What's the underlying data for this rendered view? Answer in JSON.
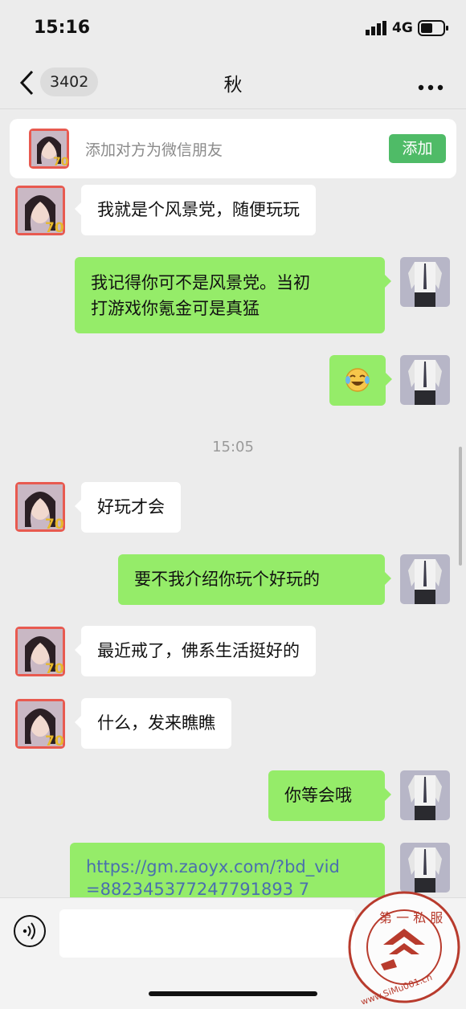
{
  "status": {
    "time": "15:16",
    "network": "4G"
  },
  "header": {
    "unread_count": "3402",
    "title": "秋"
  },
  "add_friend": {
    "prompt": "添加对方为微信朋友",
    "button_label": "添加"
  },
  "timestamp": "15:05",
  "messages": [
    {
      "side": "in",
      "text": "我就是个风景党，随便玩玩"
    },
    {
      "side": "out",
      "lines": [
        "我记得你可不是风景党。当初",
        "打游戏你氪金可是真猛"
      ]
    },
    {
      "side": "out",
      "emoji": "laughing-crying-emoji"
    },
    {
      "side": "in",
      "text": "好玩才会"
    },
    {
      "side": "out",
      "text": "要不我介绍你玩个好玩的"
    },
    {
      "side": "in",
      "text": "最近戒了，佛系生活挺好的"
    },
    {
      "side": "in",
      "text": "什么，发来瞧瞧"
    },
    {
      "side": "out",
      "text": "你等会哦"
    },
    {
      "side": "out",
      "link_lines": [
        "https://gm.zaoyx.com/?bd_vid",
        "=882345377247791893 7"
      ]
    }
  ],
  "watermark": {
    "top": "第 一 私 服",
    "bottom": "www.SiMu001.cn"
  },
  "colors": {
    "outgoing_bubble": "#95ec69",
    "incoming_bubble": "#ffffff",
    "add_button": "#4fbb67",
    "link": "#4a6fae"
  }
}
